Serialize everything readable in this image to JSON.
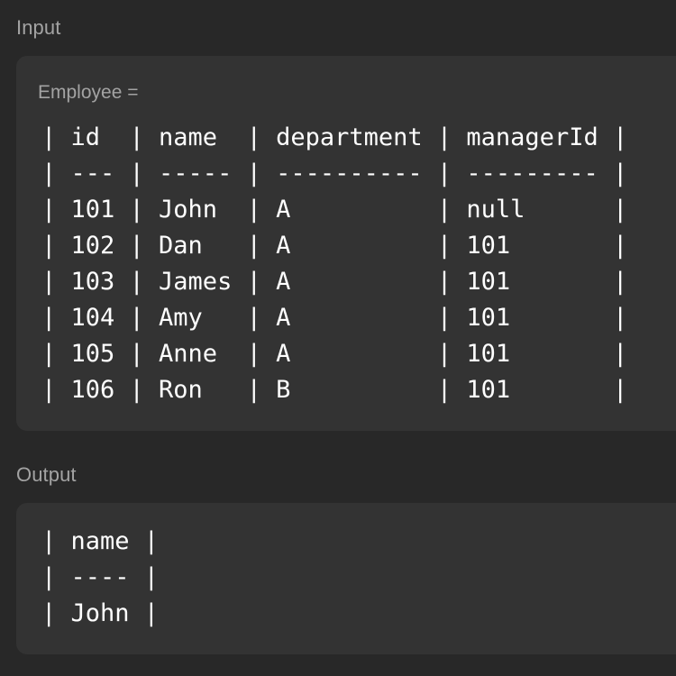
{
  "input": {
    "heading": "Input",
    "variable_label": "Employee =",
    "table_lines": [
      "| id  | name  | department | managerId |",
      "| --- | ----- | ---------- | --------- |",
      "| 101 | John  | A          | null      |",
      "| 102 | Dan   | A          | 101       |",
      "| 103 | James | A          | 101       |",
      "| 104 | Amy   | A          | 101       |",
      "| 105 | Anne  | A          | 101       |",
      "| 106 | Ron   | B          | 101       |"
    ]
  },
  "output": {
    "heading": "Output",
    "table_lines": [
      "| name |",
      "| ---- |",
      "| John |"
    ]
  },
  "colors": {
    "background": "#282828",
    "panel": "#333333",
    "label": "#a3a3a3",
    "code_text": "#ffffff"
  }
}
